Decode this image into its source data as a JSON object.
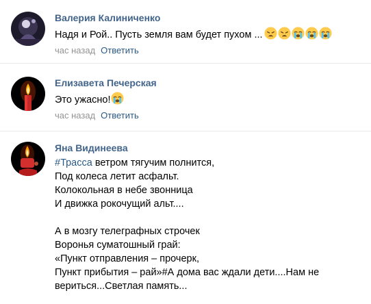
{
  "comments": [
    {
      "author": "Валерия Калиниченко",
      "text": "Надя и Рой.. Пусть земля вам будет пухом ...",
      "emojis": [
        "weary-face-emoji",
        "weary-face-emoji",
        "crying-face-emoji",
        "crying-face-emoji",
        "crying-face-emoji"
      ],
      "time": "час назад",
      "reply_label": "Ответить"
    },
    {
      "author": "Елизавета Печерская",
      "text": "Это ужасно!",
      "emojis": [
        "crying-face-emoji"
      ],
      "time": "час назад",
      "reply_label": "Ответить"
    },
    {
      "author": "Яна Видинеева",
      "hashtag": "#Трасса",
      "lines": [
        " ветром тягучим полнится,",
        "Под колеса летит асфальт.",
        "Колокольная в небе звонница",
        "И движка рокочущий альт....",
        "",
        "А в мозгу телеграфных строчек",
        "Воронья суматошный грай:",
        "«Пункт отправления – прочерк,",
        "Пункт прибытия – рай»#А дома вас ждали дети....Нам не",
        "вериться...Светлая память..."
      ]
    }
  ],
  "colors": {
    "author": "#42648b",
    "link": "#2a5885",
    "meta": "#939393",
    "divider": "#e7e8ec"
  }
}
